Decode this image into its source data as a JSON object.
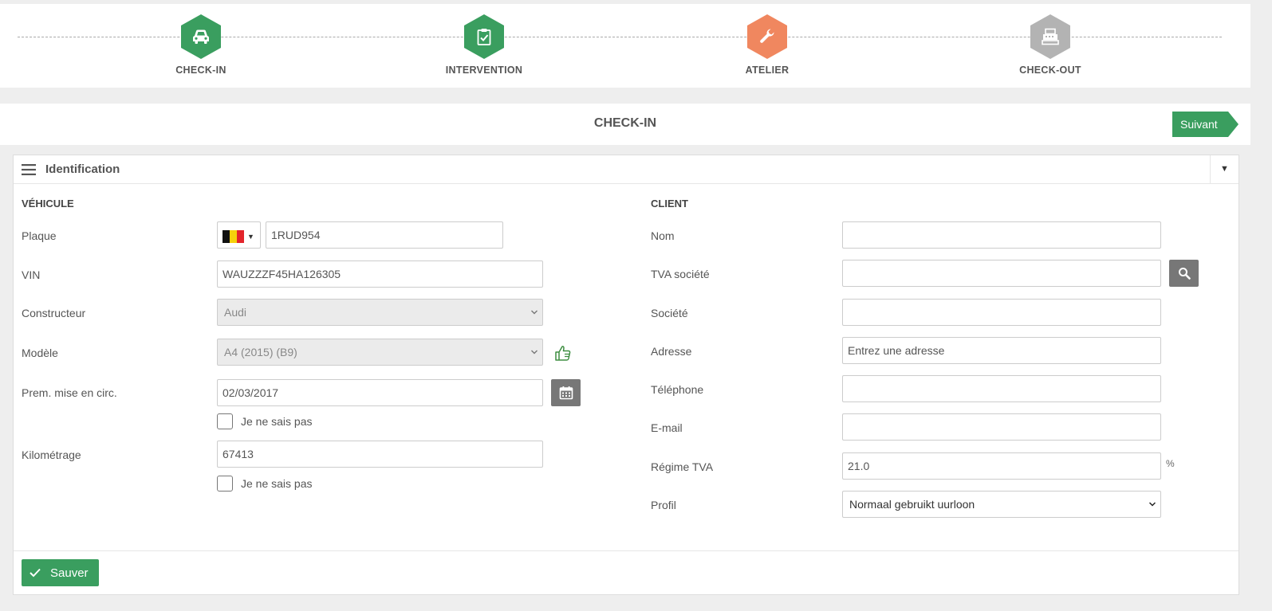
{
  "stepper": {
    "steps": [
      {
        "label": "CHECK-IN",
        "icon": "car-icon",
        "color": "#3a9e5f"
      },
      {
        "label": "INTERVENTION",
        "icon": "clipboard-check-icon",
        "color": "#3a9e5f"
      },
      {
        "label": "ATELIER",
        "icon": "wrench-icon",
        "color": "#f0875f"
      },
      {
        "label": "CHECK-OUT",
        "icon": "cash-register-icon",
        "color": "#b3b3b3"
      }
    ]
  },
  "header": {
    "title": "CHECK-IN",
    "next_label": "Suivant"
  },
  "panel": {
    "title": "Identification",
    "collapse_glyph": "▼"
  },
  "vehicle": {
    "section_title": "VÉHICULE",
    "plate": {
      "label": "Plaque",
      "country": "BE",
      "value": "1RUD954"
    },
    "vin": {
      "label": "VIN",
      "value": "WAUZZZF45HA126305"
    },
    "manufacturer": {
      "label": "Constructeur",
      "value": "Audi"
    },
    "model": {
      "label": "Modèle",
      "value": "A4 (2015) (B9)"
    },
    "first_registration": {
      "label": "Prem. mise en circ.",
      "value": "02/03/2017",
      "unknown_label": "Je ne sais pas"
    },
    "mileage": {
      "label": "Kilométrage",
      "value": "67413",
      "unknown_label": "Je ne sais pas"
    }
  },
  "client": {
    "section_title": "CLIENT",
    "name": {
      "label": "Nom",
      "value": ""
    },
    "vat_company": {
      "label": "TVA société",
      "value": ""
    },
    "company": {
      "label": "Société",
      "value": ""
    },
    "address": {
      "label": "Adresse",
      "placeholder": "Entrez une adresse"
    },
    "phone": {
      "label": "Téléphone",
      "value": ""
    },
    "email": {
      "label": "E-mail",
      "value": ""
    },
    "vat_regime": {
      "label": "Régime TVA",
      "value": "21.0",
      "unit": "%"
    },
    "profile": {
      "label": "Profil",
      "value": "Normaal gebruikt uurloon"
    }
  },
  "footer": {
    "save_label": "Sauver"
  },
  "colors": {
    "green": "#3a9e5f",
    "orange": "#f0875f",
    "grey": "#b3b3b3",
    "flag_black": "#111111",
    "flag_yellow": "#f5d10c",
    "flag_red": "#e3242b"
  }
}
